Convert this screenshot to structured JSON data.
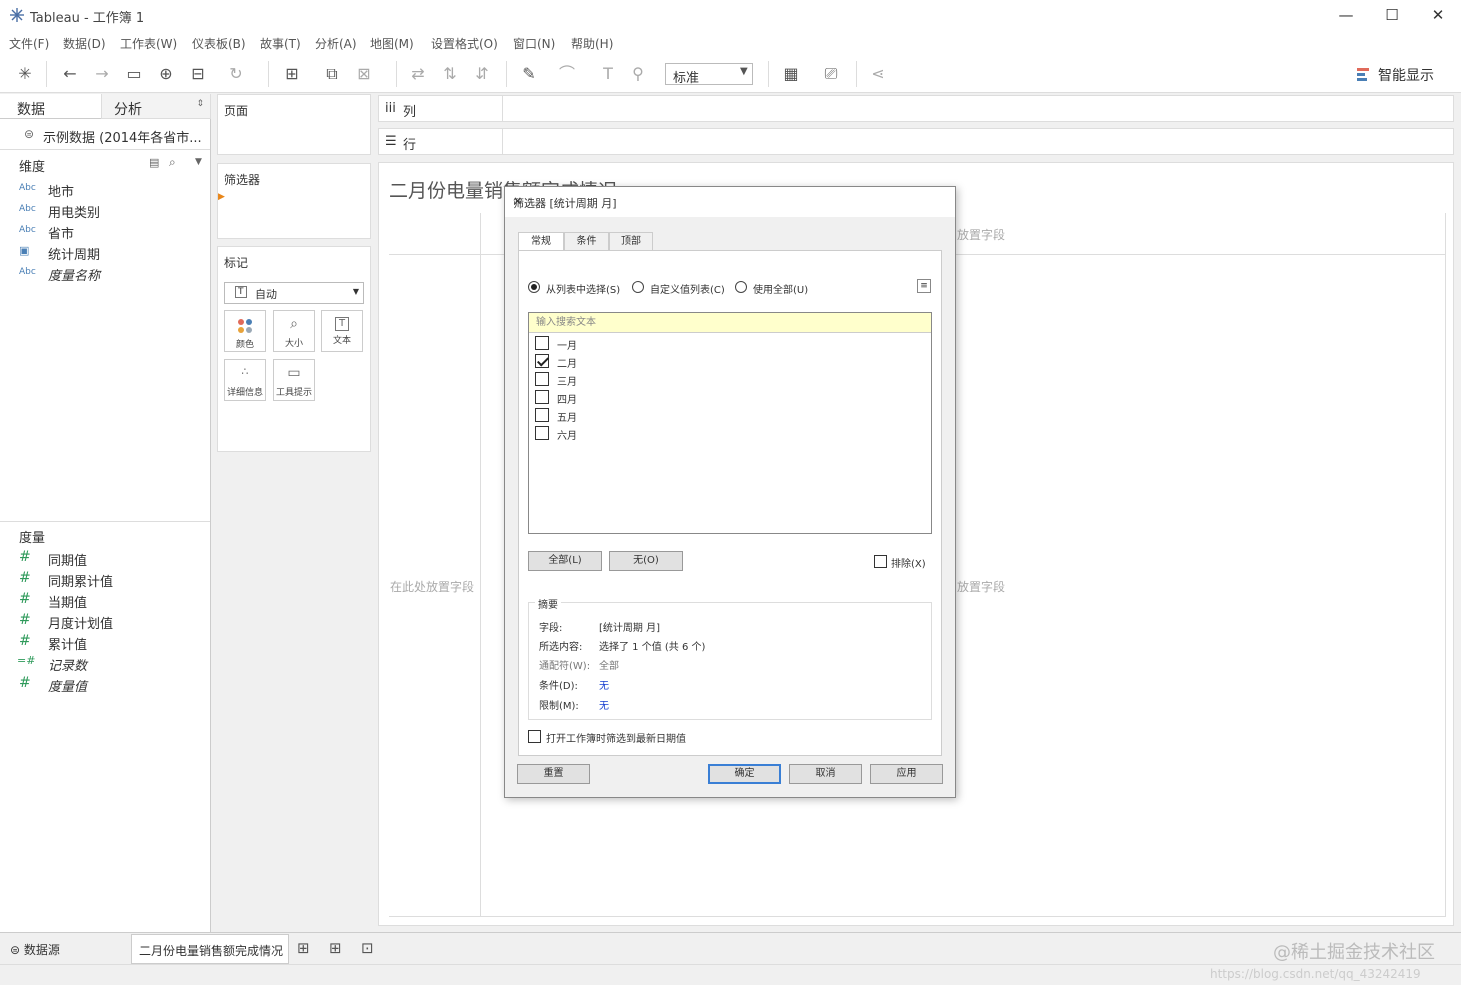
{
  "window": {
    "title": "Tableau - 工作簿 1",
    "min": "—",
    "max": "☐",
    "close": "✕"
  },
  "menu": [
    "文件(F)",
    "数据(D)",
    "工作表(W)",
    "仪表板(B)",
    "故事(T)",
    "分析(A)",
    "地图(M)",
    "设置格式(O)",
    "窗口(N)",
    "帮助(H)"
  ],
  "toolbar": {
    "fit_select": "标准",
    "smart_show": "智能显示"
  },
  "left": {
    "tab_data": "数据",
    "tab_analysis": "分析",
    "datasource": "示例数据 (2014年各省市...",
    "dimensions_header": "维度",
    "dimensions": [
      {
        "icon": "Abc",
        "label": "地市"
      },
      {
        "icon": "Abc",
        "label": "用电类别"
      },
      {
        "icon": "Abc",
        "label": "省市"
      },
      {
        "icon": "calendar",
        "label": "统计周期"
      },
      {
        "icon": "Abc",
        "label": "度量名称"
      }
    ],
    "measures_header": "度量",
    "measures": [
      {
        "icon": "#",
        "label": "同期值"
      },
      {
        "icon": "#",
        "label": "同期累计值"
      },
      {
        "icon": "#",
        "label": "当期值"
      },
      {
        "icon": "#",
        "label": "月度计划值"
      },
      {
        "icon": "#",
        "label": "累计值"
      },
      {
        "icon": "=#",
        "label": "记录数"
      },
      {
        "icon": "#",
        "label": "度量值"
      }
    ]
  },
  "cards": {
    "pages": "页面",
    "filters": "筛选器",
    "marks": "标记",
    "marks_type": "自动",
    "mark_buttons": [
      "颜色",
      "大小",
      "文本",
      "详细信息",
      "工具提示"
    ]
  },
  "shelves": {
    "columns": "列",
    "rows": "行"
  },
  "view": {
    "title": "二月份电量销售额完成情况",
    "drop_field": "在此处放置字段",
    "drop_field_partial": "放置字段"
  },
  "bottom": {
    "datasource_tab": "数据源",
    "sheet_tab": "二月份电量销售额完成情况",
    "watermark": "@稀土掘金技术社区",
    "watermark_url": "https://blog.csdn.net/qq_43242419"
  },
  "dialog": {
    "title": "筛选器 [统计周期 月]",
    "tabs": [
      "常规",
      "条件",
      "顶部"
    ],
    "radio_list": "从列表中选择(S)",
    "radio_custom": "自定义值列表(C)",
    "radio_all": "使用全部(U)",
    "search_placeholder": "输入搜索文本",
    "items": [
      {
        "label": "一月",
        "checked": false
      },
      {
        "label": "二月",
        "checked": true
      },
      {
        "label": "三月",
        "checked": false
      },
      {
        "label": "四月",
        "checked": false
      },
      {
        "label": "五月",
        "checked": false
      },
      {
        "label": "六月",
        "checked": false
      }
    ],
    "btn_all": "全部(L)",
    "btn_none": "无(O)",
    "exclude": "排除(X)",
    "summary": {
      "caption": "摘要",
      "field_label": "字段:",
      "field_value": "[统计周期 月]",
      "selected_label": "所选内容:",
      "selected_value": "选择了 1 个值 (共 6 个)",
      "wildcard_label": "通配符(W):",
      "wildcard_value": "全部",
      "condition_label": "条件(D):",
      "condition_value": "无",
      "limit_label": "限制(M):",
      "limit_value": "无"
    },
    "latest_date": "打开工作簿时筛选到最新日期值",
    "btn_reset": "重置",
    "btn_ok": "确定",
    "btn_cancel": "取消",
    "btn_apply": "应用"
  }
}
